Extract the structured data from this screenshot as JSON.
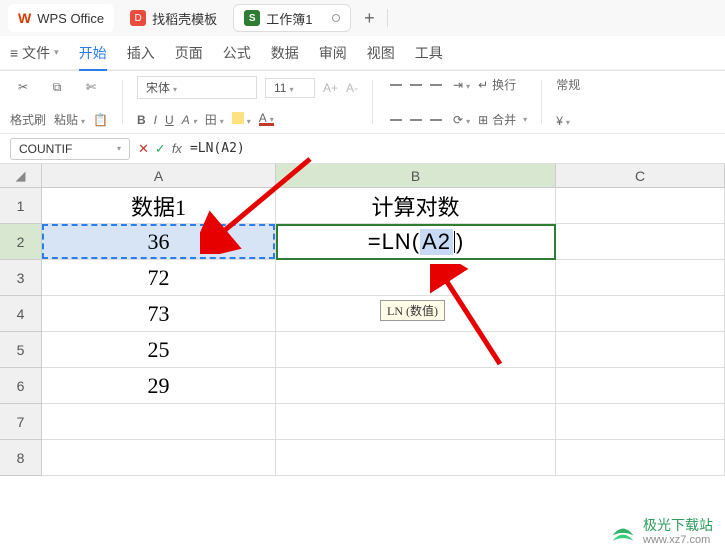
{
  "titlebar": {
    "app_name": "WPS Office",
    "tab1": "找稻壳模板",
    "tab2": "工作簿1",
    "add": "+"
  },
  "menu": {
    "file_icon": "≡",
    "file": "文件",
    "start": "开始",
    "insert": "插入",
    "page": "页面",
    "formula": "公式",
    "data": "数据",
    "review": "审阅",
    "view": "视图",
    "tools": "工具"
  },
  "ribbon": {
    "format_painter": "格式刷",
    "paste": "粘贴",
    "font": "宋体",
    "size": "11",
    "bold": "B",
    "italic": "I",
    "underline": "U",
    "strike": "A",
    "border": "田",
    "fill": "◆",
    "font_color": "A",
    "inc_font": "A+",
    "dec_font": "A-",
    "wrap": "换行",
    "merge": "合并",
    "general": "常规"
  },
  "namebox": "COUNTIF",
  "formula": "=LN(A2)",
  "columns": {
    "A": "A",
    "B": "B",
    "C": "C"
  },
  "rows": [
    "1",
    "2",
    "3",
    "4",
    "5",
    "6",
    "7",
    "8"
  ],
  "cells": {
    "A1": "数据1",
    "B1": "计算对数",
    "A2": "36",
    "A3": "72",
    "A4": "73",
    "A5": "25",
    "A6": "29",
    "B2_prefix": "=LN(",
    "B2_ref": "A2",
    "B2_suffix": ")"
  },
  "tooltip": "LN (数值)",
  "watermark": {
    "name": "极光下载站",
    "url": "www.xz7.com"
  }
}
